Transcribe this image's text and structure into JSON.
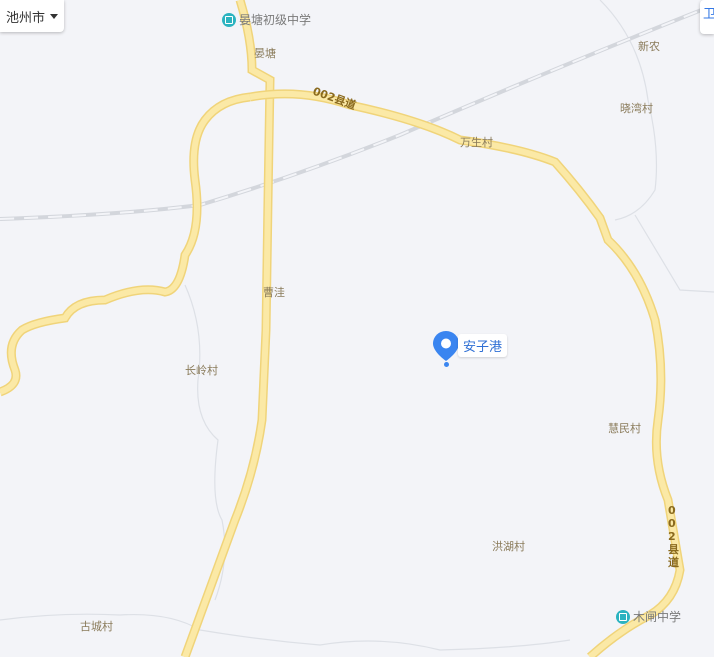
{
  "city_selector": {
    "label": "池州市"
  },
  "right_button": {
    "label": "卫"
  },
  "marker": {
    "label": "安子港"
  },
  "roads": {
    "county_road_label": "002县道",
    "county_road_label_vertical": "002县道"
  },
  "pois": [
    {
      "label": "晏塘初级中学"
    },
    {
      "label": "木闸中学"
    }
  ],
  "places": [
    {
      "label": "晏塘"
    },
    {
      "label": "新农"
    },
    {
      "label": "晓湾村"
    },
    {
      "label": "万生村"
    },
    {
      "label": "曹洼"
    },
    {
      "label": "长岭村"
    },
    {
      "label": "慧民村"
    },
    {
      "label": "洪湖村"
    },
    {
      "label": "古城村"
    }
  ],
  "colors": {
    "background": "#f3f4f8",
    "road": "#fbe9a6",
    "road_border": "#f0d47a",
    "railway": "#d9dbe0",
    "marker": "#3a85f0"
  }
}
